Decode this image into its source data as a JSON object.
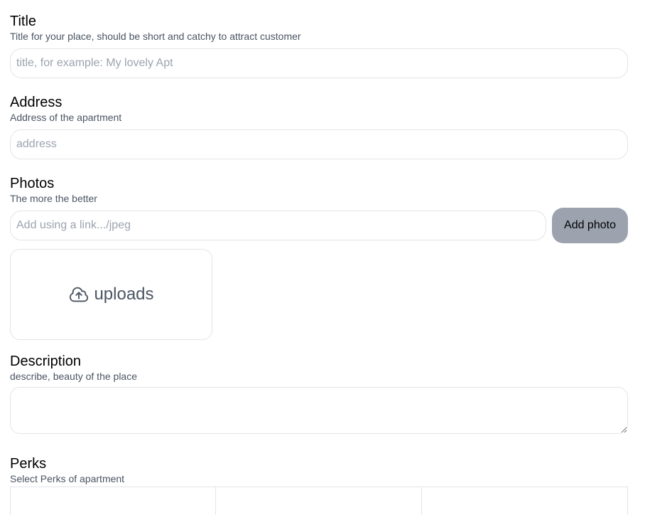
{
  "sections": {
    "title": {
      "heading": "Title",
      "hint": "Title for your place, should be short and catchy to attract customer",
      "placeholder": "title, for example: My lovely Apt",
      "value": ""
    },
    "address": {
      "heading": "Address",
      "hint": "Address of the apartment",
      "placeholder": "address",
      "value": ""
    },
    "photos": {
      "heading": "Photos",
      "hint": "The more the better",
      "placeholder": "Add using a link.../jpeg",
      "value": "",
      "add_button_label": "Add photo",
      "upload_label": "uploads",
      "upload_icon": "cloud-upload-icon"
    },
    "description": {
      "heading": "Description",
      "hint": "describe, beauty of the place",
      "value": ""
    },
    "perks": {
      "heading": "Perks",
      "hint": "Select Perks of apartment"
    }
  },
  "colors": {
    "hint_text": "#4b5563",
    "placeholder_text": "#9ca3af",
    "border": "#e2e4e8",
    "add_button_bg": "#9ca3af"
  }
}
